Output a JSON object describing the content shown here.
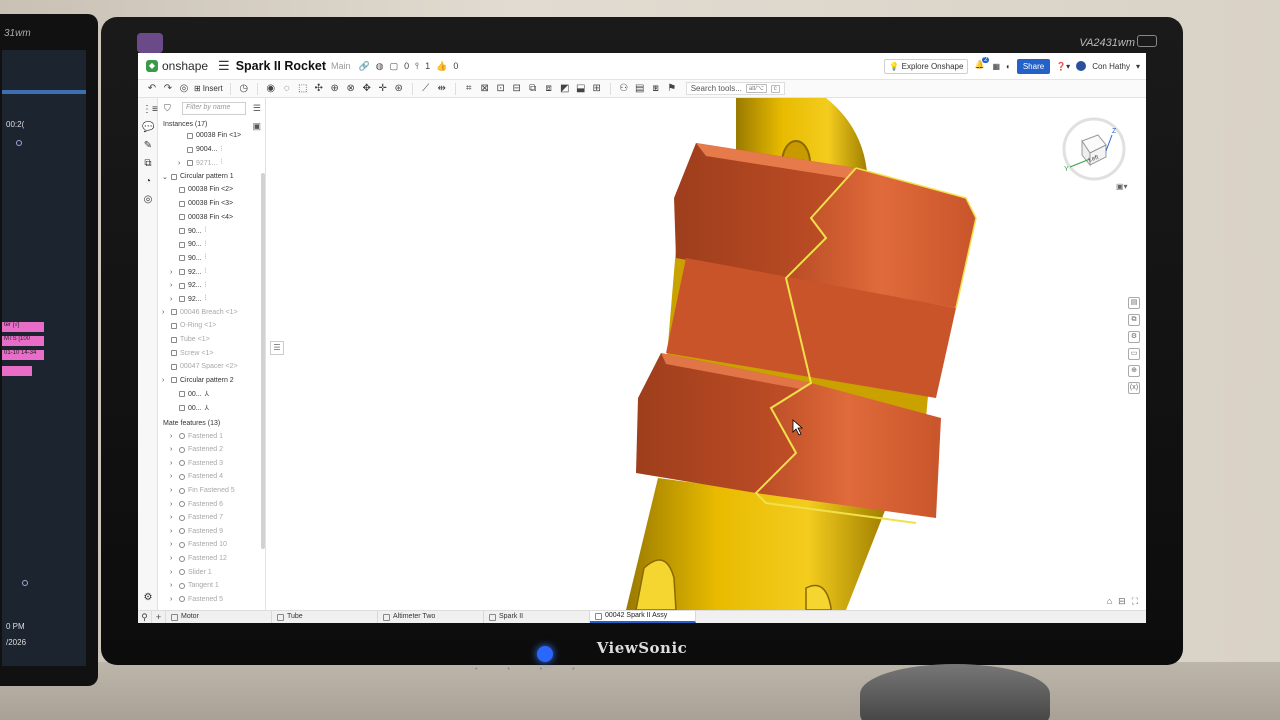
{
  "app": {
    "logo_text": "onshape",
    "doc_title": "Spark II Rocket",
    "branch": "Main",
    "stats": {
      "versions": "0",
      "branches": "1",
      "likes": "0"
    },
    "explore_label": "Explore Onshape",
    "notifications_count": "2",
    "share_label": "Share",
    "user_name": "Con Hathy"
  },
  "toolbar": {
    "insert_label": "Insert",
    "search_placeholder": "Search tools...",
    "search_shortcut_1": "alt/⌥",
    "search_shortcut_2": "c"
  },
  "tree": {
    "filter_placeholder": "Filter by name",
    "instances_title": "Instances (17)",
    "items": [
      {
        "label": "00038 Fin <1>",
        "dim": false
      },
      {
        "label": "9004...",
        "dim": false
      },
      {
        "label": "9271...",
        "dim": true
      },
      {
        "label": "Circular pattern 1",
        "dim": false
      },
      {
        "label": "00038 Fin <2>",
        "dim": false
      },
      {
        "label": "00038 Fin <3>",
        "dim": false
      },
      {
        "label": "00038 Fin <4>",
        "dim": false
      },
      {
        "label": "90...",
        "dim": false
      },
      {
        "label": "90...",
        "dim": false
      },
      {
        "label": "90...",
        "dim": false
      },
      {
        "label": "92...",
        "dim": false
      },
      {
        "label": "92...",
        "dim": false
      },
      {
        "label": "92...",
        "dim": false
      },
      {
        "label": "00046 Breach <1>",
        "dim": true
      },
      {
        "label": "O-Ring <1>",
        "dim": true
      },
      {
        "label": "Tube <1>",
        "dim": true
      },
      {
        "label": "Screw <1>",
        "dim": true
      },
      {
        "label": "00047 Spacer <2>",
        "dim": true
      },
      {
        "label": "Circular pattern 2",
        "dim": false
      },
      {
        "label": "00...",
        "dim": false
      },
      {
        "label": "00...",
        "dim": false
      }
    ],
    "mates_title": "Mate features (13)",
    "mates": [
      "Fastened 1",
      "Fastened 2",
      "Fastened 3",
      "Fastened 4",
      "Fin Fastened 5",
      "Fastened 6",
      "Fastened 7",
      "Fastened 9",
      "Fastened 10",
      "Fastened 12",
      "Slider 1",
      "Tangent 1",
      "Fastened 5"
    ]
  },
  "viewcube": {
    "face_label": "Left",
    "axis_z": "Z",
    "axis_y": "Y"
  },
  "tabs": [
    {
      "label": "Motor",
      "active": false
    },
    {
      "label": "Tube",
      "active": false
    },
    {
      "label": "Altimeter Two",
      "active": false
    },
    {
      "label": "Spark II",
      "active": false
    },
    {
      "label": "00042 Spark II Assy",
      "active": true
    }
  ],
  "monitor": {
    "brand": "ViewSonic",
    "model": "VA2431wm",
    "left_model": "31wm",
    "left_time": "00:2(",
    "left_pink_1": "ter [√]",
    "left_pink_2": "MTS [100",
    "left_pink_3": "01-10 14-34",
    "left_clock": "0 PM",
    "left_date": "/2026"
  },
  "colors": {
    "rocket_body": "#e2b400",
    "coupler": "#d95f32",
    "accent": "#2461c8",
    "highlight": "#f1e04a"
  }
}
